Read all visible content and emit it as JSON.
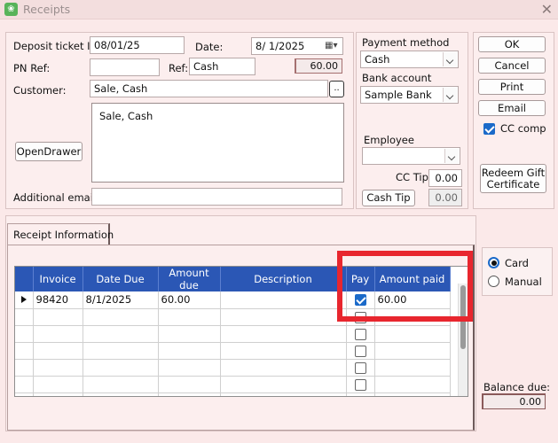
{
  "window": {
    "title": "Receipts",
    "close_glyph": "✕"
  },
  "header": {
    "deposit_ticket_id_label": "Deposit ticket ID",
    "deposit_ticket_id_value": "08/01/25",
    "date_label": "Date:",
    "date_value": "8/  1/2025",
    "pn_ref_label": "PN Ref:",
    "pn_ref_value": "",
    "ref_label": "Ref:",
    "ref_value": "Cash",
    "amount_display": "60.00",
    "customer_label": "Customer:",
    "customer_value": "Sale, Cash",
    "customer_lookup_label": "..",
    "address_text": "Sale, Cash",
    "open_drawer_label": "OpenDrawer",
    "additional_email_label": "Additional email",
    "additional_email_value": ""
  },
  "payment": {
    "method_label": "Payment method",
    "method_value": "Cash",
    "bank_label": "Bank account",
    "bank_value": "Sample Bank",
    "employee_label": "Employee",
    "employee_value": "",
    "cc_tip_label": "CC Tip",
    "cc_tip_value": "0.00",
    "cash_tip_label": "Cash Tip",
    "cash_tip_value": "0.00"
  },
  "actions": {
    "ok": "OK",
    "cancel": "Cancel",
    "print": "Print",
    "email": "Email",
    "cc_comp_label": "CC comp",
    "cc_comp_checked": true,
    "redeem_line1": "Redeem Gift",
    "redeem_line2": "Certificate"
  },
  "tabs": {
    "receipt_info": "Receipt Information"
  },
  "grid": {
    "columns": [
      "Invoice",
      "Date Due",
      "Amount due",
      "Description",
      "Pay",
      "Amount paid"
    ],
    "rows": [
      {
        "invoice": "98420",
        "date_due": "8/1/2025",
        "amount_due": "60.00",
        "description": "",
        "pay": true,
        "amount_paid": "60.00"
      }
    ],
    "empty_rows": 6
  },
  "payment_mode": {
    "card_label": "Card",
    "manual_label": "Manual",
    "selected": "card"
  },
  "balance": {
    "label": "Balance due:",
    "value": "0.00"
  },
  "colors": {
    "header_blue": "#2b57b5",
    "highlight_red": "#e8262e",
    "check_blue": "#1b6ac9"
  }
}
